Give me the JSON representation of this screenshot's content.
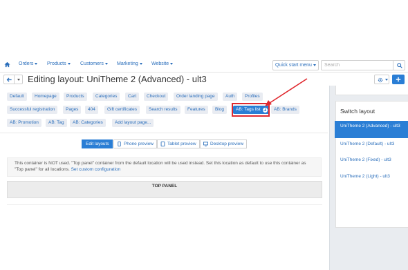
{
  "topnav": {
    "items": [
      {
        "label": "Orders"
      },
      {
        "label": "Products"
      },
      {
        "label": "Customers"
      },
      {
        "label": "Marketing"
      },
      {
        "label": "Website"
      }
    ],
    "quick_start": "Quick start menu",
    "search_placeholder": "Search"
  },
  "header": {
    "title": "Editing layout: UniTheme 2 (Advanced) - ult3"
  },
  "location_tabs": [
    "Default",
    "Homepage",
    "Products",
    "Categories",
    "Cart",
    "Checkout",
    "Order landing page",
    "Auth",
    "Profiles",
    "Successful registration",
    "Pages",
    "404",
    "Gift certificates",
    "Search results",
    "Features",
    "Blog",
    "AB: Tags list",
    "AB: Brands",
    "AB: Promotion",
    "AB: Tag",
    "AB: Categories",
    "Add layout page..."
  ],
  "selected_tab": "AB: Tags list",
  "preview_tabs": [
    "Edit layouts",
    "Phone preview",
    "Tablet preview",
    "Desktop preview"
  ],
  "notice": {
    "text": "This container is NOT used. \"Top panel\" container from the default location will be used instead. Set this location as default to use this container as \"Top panel\" for all locations.",
    "link": "Set custom configuration"
  },
  "container": {
    "title": "TOP PANEL"
  },
  "sidebar": {
    "title": "Switch layout",
    "items": [
      "UniTheme 2 (Advanced) - ult3",
      "UniTheme 2 (Default) - ult3",
      "UniTheme 2 (Fixed) - ult3",
      "UniTheme 2 (Light) - ult3"
    ]
  },
  "colors": {
    "accent": "#2a7ed5",
    "link": "#2a6ebb",
    "annotation": "#e0282e",
    "tag_bg": "#e9ecf2"
  }
}
